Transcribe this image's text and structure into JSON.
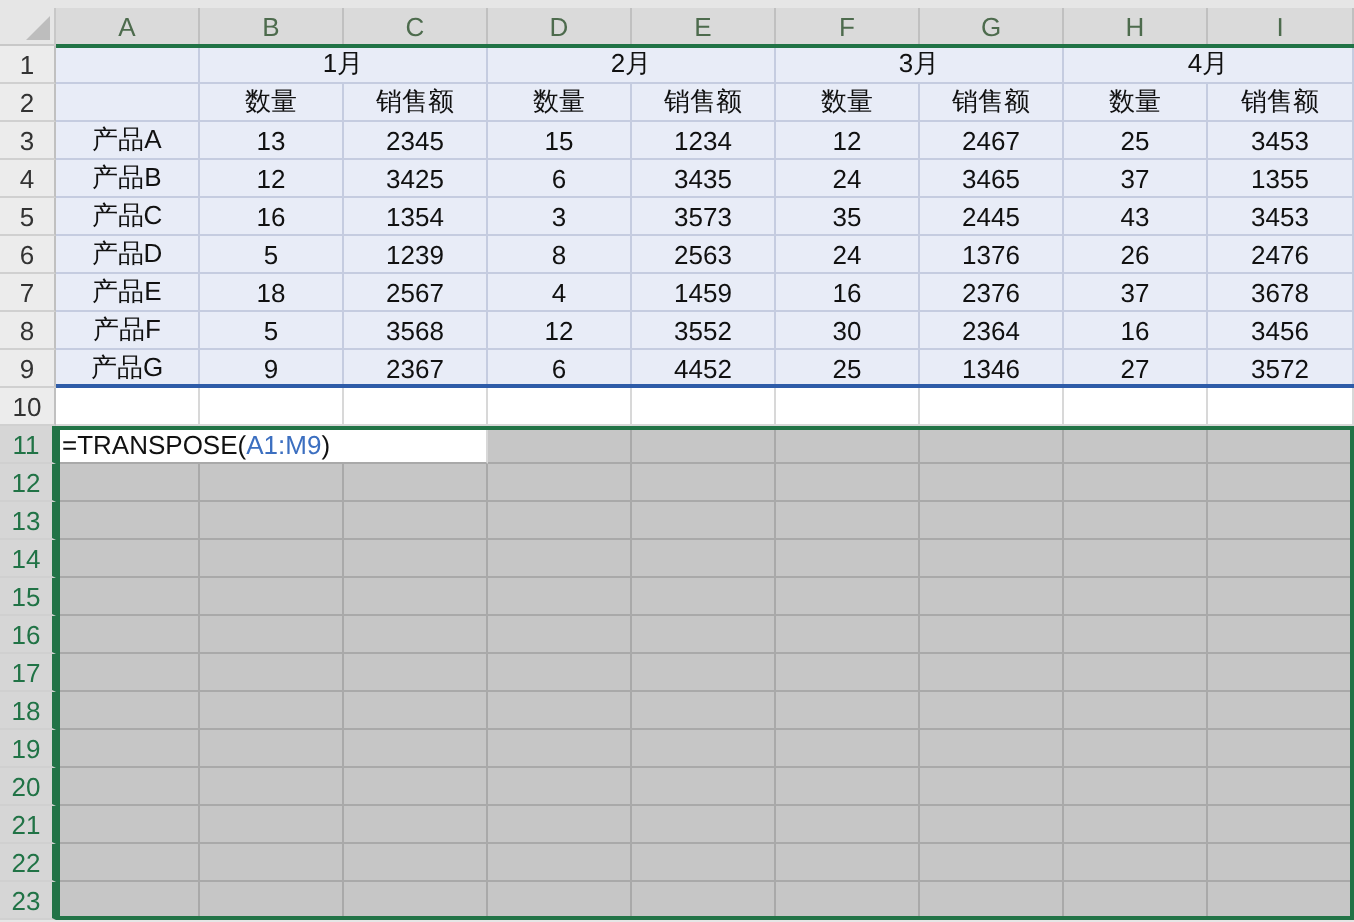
{
  "columns": [
    "A",
    "B",
    "C",
    "D",
    "E",
    "F",
    "G",
    "H",
    "I"
  ],
  "row_numbers": [
    "1",
    "2",
    "3",
    "4",
    "5",
    "6",
    "7",
    "8",
    "9",
    "10",
    "11",
    "12",
    "13",
    "14",
    "15",
    "16",
    "17",
    "18",
    "19",
    "20",
    "21",
    "22",
    "23"
  ],
  "months": [
    "1月",
    "2月",
    "3月",
    "4月"
  ],
  "subheaders": [
    "数量",
    "销售额",
    "数量",
    "销售额",
    "数量",
    "销售额",
    "数量",
    "销售额"
  ],
  "rows": [
    {
      "label": "产品A",
      "values": [
        "13",
        "2345",
        "15",
        "1234",
        "12",
        "2467",
        "25",
        "3453"
      ]
    },
    {
      "label": "产品B",
      "values": [
        "12",
        "3425",
        "6",
        "3435",
        "24",
        "3465",
        "37",
        "1355"
      ]
    },
    {
      "label": "产品C",
      "values": [
        "16",
        "1354",
        "3",
        "3573",
        "35",
        "2445",
        "43",
        "3453"
      ]
    },
    {
      "label": "产品D",
      "values": [
        "5",
        "1239",
        "8",
        "2563",
        "24",
        "1376",
        "26",
        "2476"
      ]
    },
    {
      "label": "产品E",
      "values": [
        "18",
        "2567",
        "4",
        "1459",
        "16",
        "2376",
        "37",
        "3678"
      ]
    },
    {
      "label": "产品F",
      "values": [
        "5",
        "3568",
        "12",
        "3552",
        "30",
        "2364",
        "16",
        "3456"
      ]
    },
    {
      "label": "产品G",
      "values": [
        "9",
        "2367",
        "6",
        "4452",
        "25",
        "1346",
        "27",
        "3572"
      ]
    }
  ],
  "formula": {
    "start": "=TRANSPOSE(",
    "reference": "A1:M9",
    "end": ")"
  }
}
